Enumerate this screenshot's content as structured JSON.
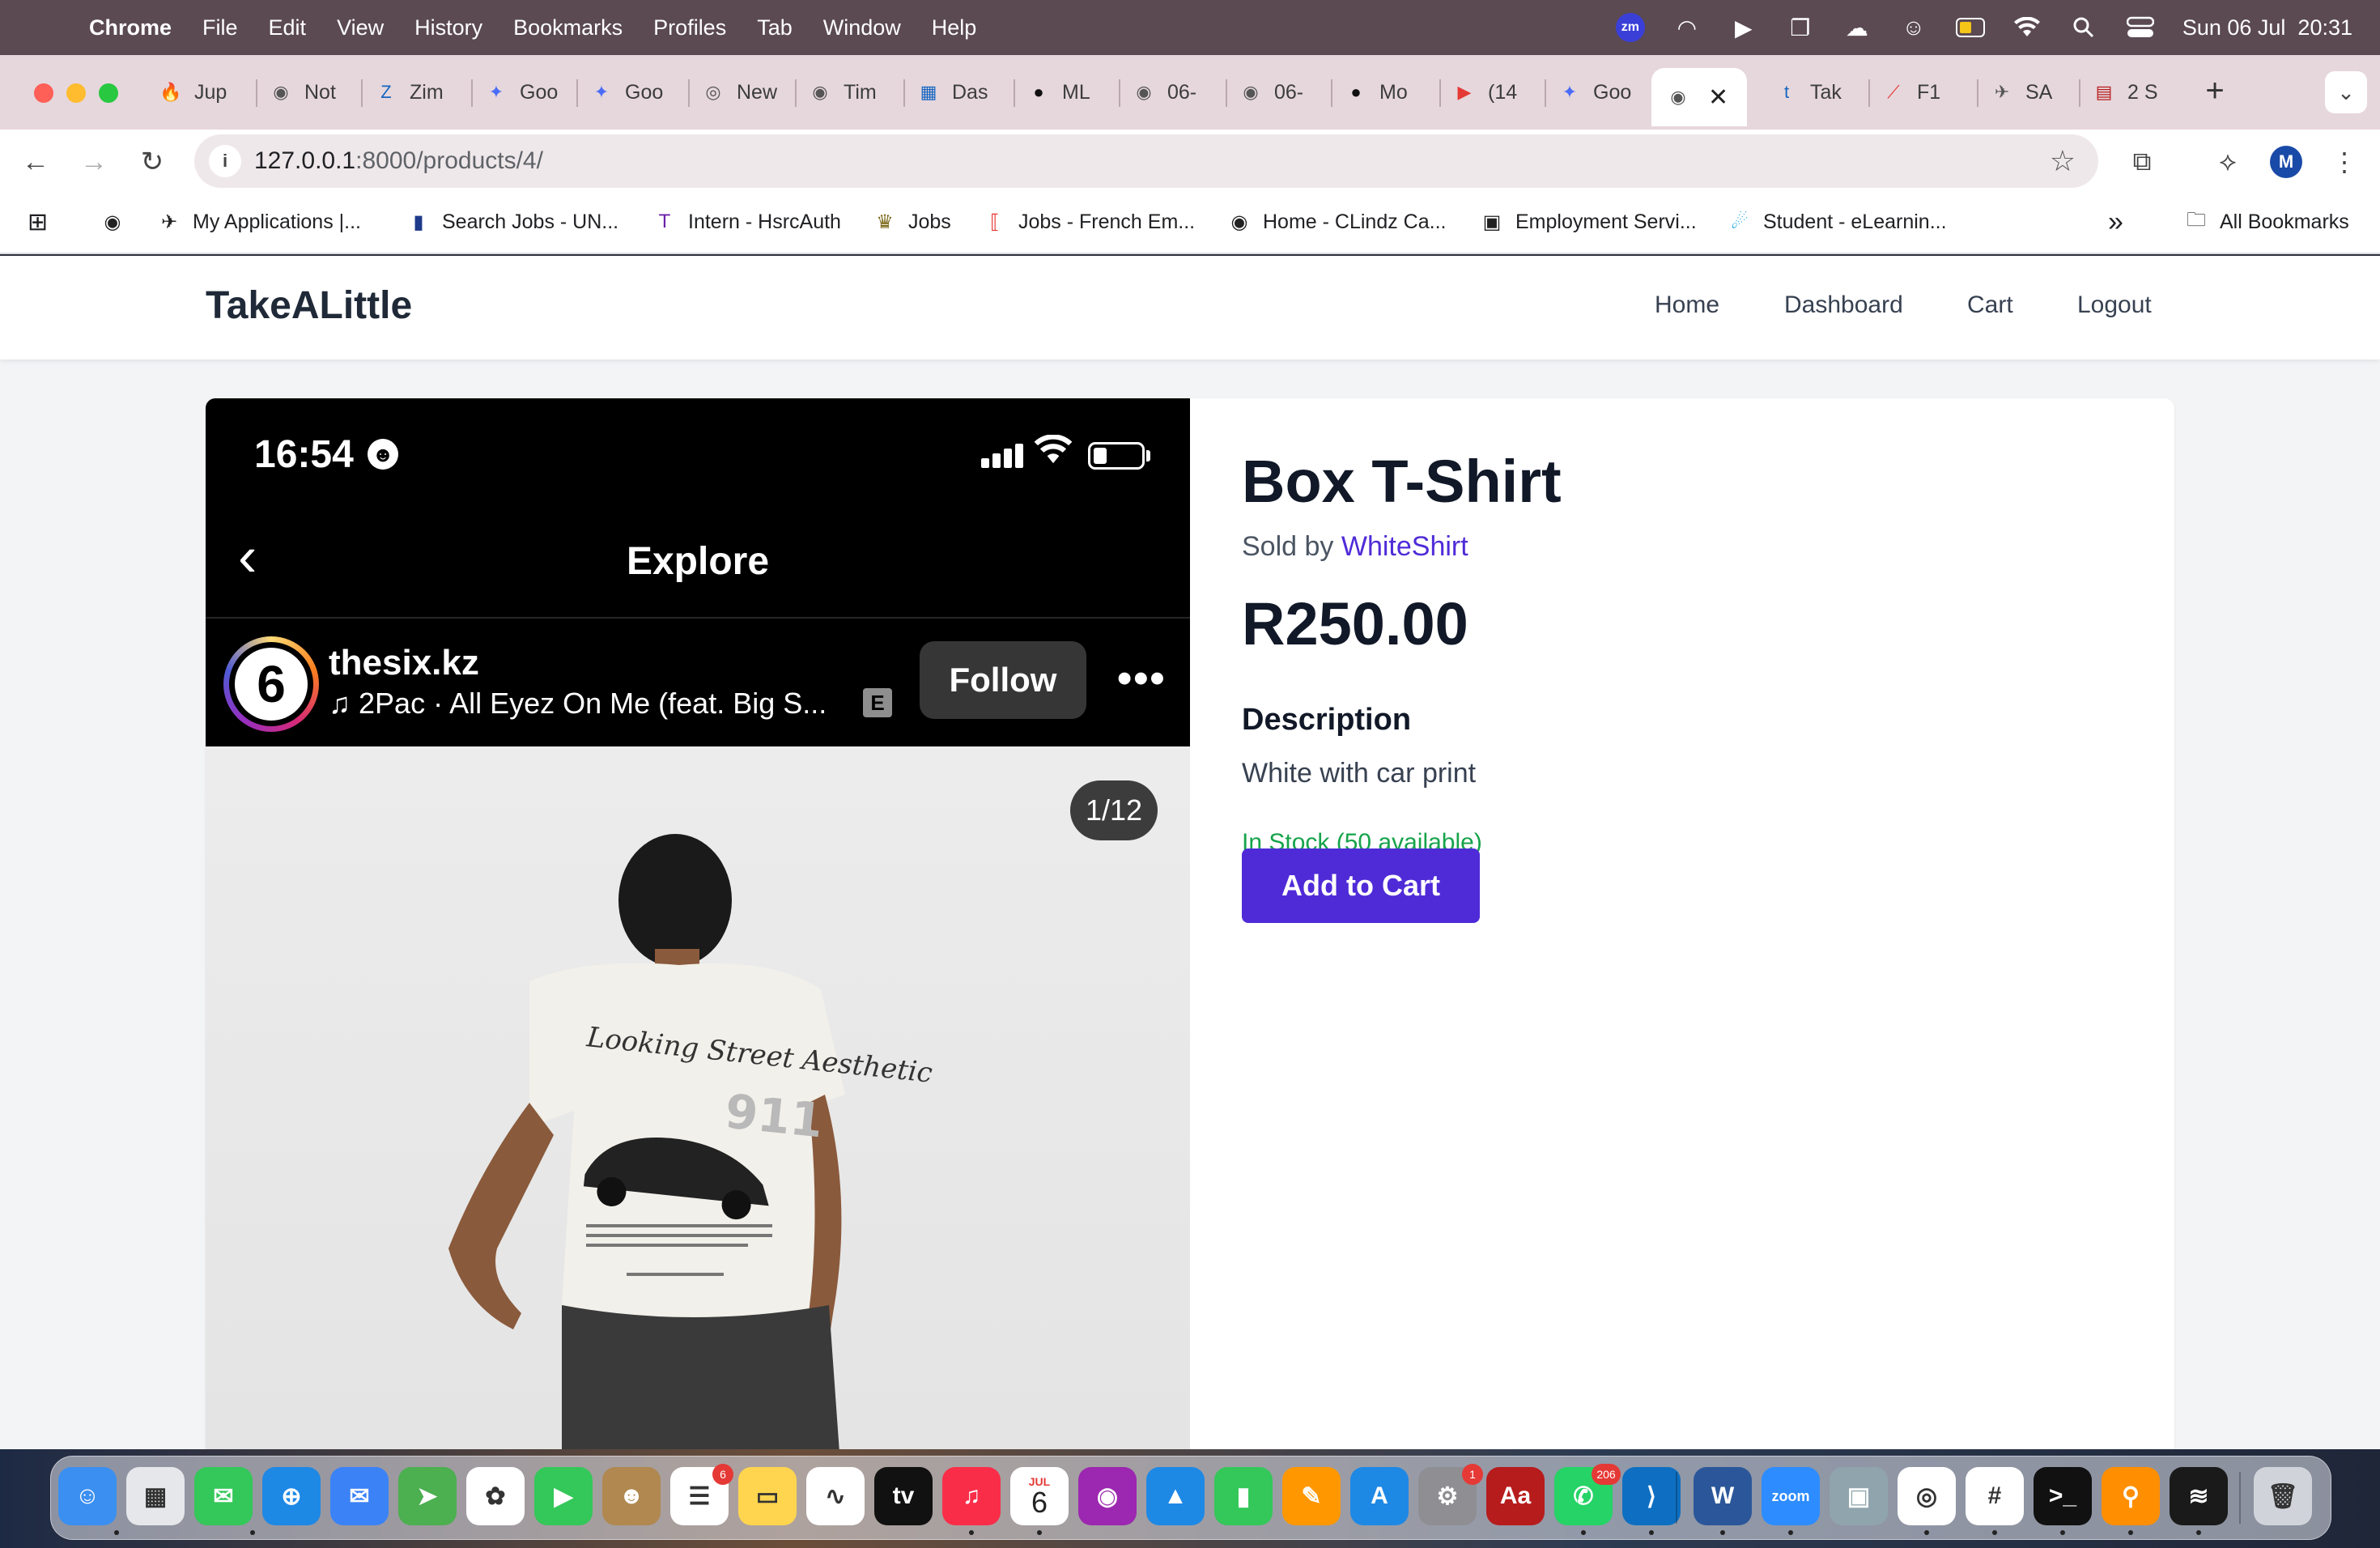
{
  "menubar": {
    "app": "Chrome",
    "items": [
      "File",
      "Edit",
      "View",
      "History",
      "Bookmarks",
      "Profiles",
      "Tab",
      "Window",
      "Help"
    ],
    "zoom_badge": "zm",
    "datetime": "Sun 06 Jul  20:31"
  },
  "tabs": [
    {
      "label": "Jup",
      "icon": "fire-icon",
      "color": "#f57c00"
    },
    {
      "label": "Not",
      "icon": "globe-icon",
      "color": "#555555"
    },
    {
      "label": "Zim",
      "icon": "zim-icon",
      "color": "#1565c0"
    },
    {
      "label": "Goo",
      "icon": "gemini-icon",
      "color": "#4a6cf7"
    },
    {
      "label": "Goo",
      "icon": "gemini-icon",
      "color": "#4a6cf7"
    },
    {
      "label": "New",
      "icon": "chrome-icon",
      "color": "#555555"
    },
    {
      "label": "Tim",
      "icon": "globe-icon",
      "color": "#555555"
    },
    {
      "label": "Das",
      "icon": "dashboard-icon",
      "color": "#1565c0"
    },
    {
      "label": "ML",
      "icon": "github-icon",
      "color": "#111111"
    },
    {
      "label": "06-",
      "icon": "globe-icon",
      "color": "#555555"
    },
    {
      "label": "06-",
      "icon": "globe-icon",
      "color": "#555555"
    },
    {
      "label": "Mo",
      "icon": "github-icon",
      "color": "#111111"
    },
    {
      "label": "(14",
      "icon": "youtube-icon",
      "color": "#e53935"
    },
    {
      "label": "Goo",
      "icon": "gemini-icon",
      "color": "#4a6cf7"
    },
    {
      "label": "",
      "icon": "globe-icon",
      "color": "#555555",
      "active": true
    },
    {
      "label": "Tak",
      "icon": "t-icon",
      "color": "#1565c0"
    },
    {
      "label": "F1",
      "icon": "f1-icon",
      "color": "#e53935"
    },
    {
      "label": "SA",
      "icon": "sa-icon",
      "color": "#555555"
    },
    {
      "label": "2 S",
      "icon": "book-icon",
      "color": "#b71c1c"
    }
  ],
  "toolbar": {
    "url_host": "127.0.0.1",
    "url_rest": ":8000/products/4/",
    "profile_initial": "M"
  },
  "bookmarks": [
    {
      "label": "",
      "icon": "globe-icon"
    },
    {
      "label": "My Applications |...",
      "icon": "sa-icon"
    },
    {
      "label": "Search Jobs - UN...",
      "icon": "doc-icon"
    },
    {
      "label": "Intern - HsrcAuth",
      "icon": "t-icon"
    },
    {
      "label": "Jobs",
      "icon": "crest-icon"
    },
    {
      "label": "Jobs - French Em...",
      "icon": "bracket-icon"
    },
    {
      "label": "Home - CLindz Ca...",
      "icon": "globe-icon"
    },
    {
      "label": "Employment Servi...",
      "icon": "picture-icon"
    },
    {
      "label": "Student - eLearnin...",
      "icon": "elearn-icon"
    }
  ],
  "bookmarks_overflow": "»",
  "all_bookmarks": "All Bookmarks",
  "site": {
    "brand": "TakeALittle",
    "nav": [
      "Home",
      "Dashboard",
      "Cart",
      "Logout"
    ]
  },
  "product": {
    "title": "Box T-Shirt",
    "sold_by_prefix": "Sold by",
    "seller": "WhiteShirt",
    "price": "R250.00",
    "description_heading": "Description",
    "description": "White with car print",
    "stock": "In Stock (50 available)",
    "add_to_cart": "Add to Cart"
  },
  "product_image": {
    "phone_time": "16:54",
    "screen_title": "Explore",
    "avatar_text": "6",
    "username": "thesix.kz",
    "song": "2Pac · All Eyez On Me (feat. Big S...",
    "explicit": "E",
    "follow": "Follow",
    "more": "•••",
    "counter": "1/12",
    "shirt_script": "Looking Street Aesthetic",
    "shirt_number": "911"
  },
  "dock": {
    "badges": {
      "reminders": "6",
      "settings": "1",
      "whatsapp": "206"
    },
    "calendar_month": "JUL",
    "calendar_day": "6"
  }
}
